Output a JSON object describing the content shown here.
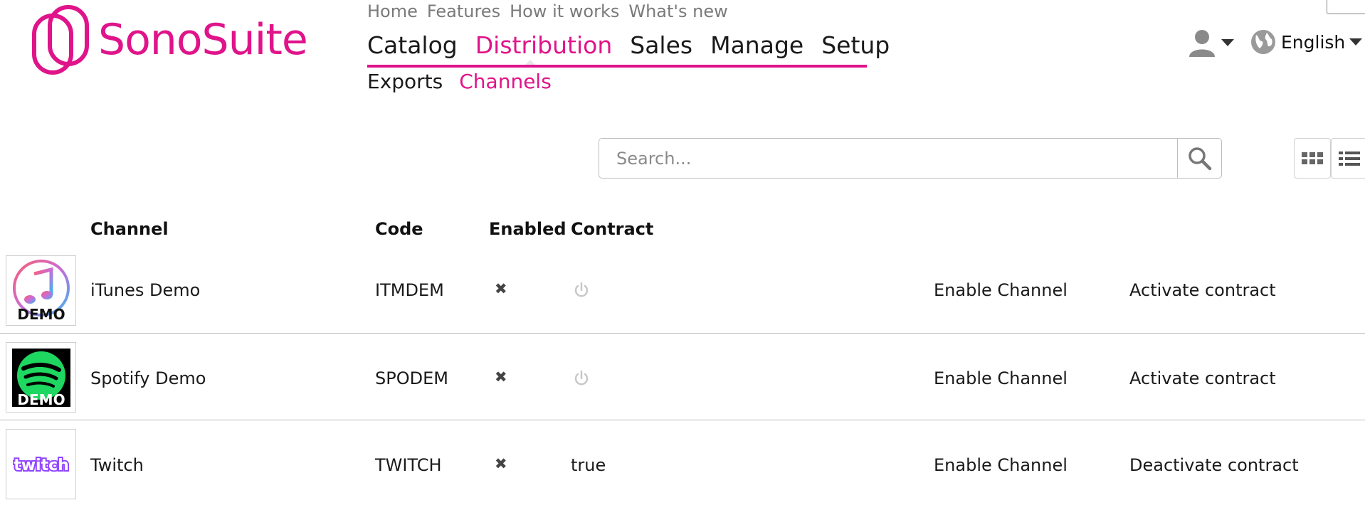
{
  "header": {
    "logo_text": "SonoSuite",
    "top_links": [
      "Home",
      "Features",
      "How it works",
      "What's new"
    ],
    "main_nav": [
      "Catalog",
      "Distribution",
      "Sales",
      "Manage",
      "Setup"
    ],
    "main_nav_active": "Distribution",
    "sub_nav": [
      "Exports",
      "Channels"
    ],
    "sub_nav_active": "Channels",
    "language": "English"
  },
  "search": {
    "placeholder": "Search..."
  },
  "table": {
    "headers": {
      "channel": "Channel",
      "code": "Code",
      "enabled": "Enabled",
      "contract": "Contract"
    },
    "rows": [
      {
        "channel": "iTunes Demo",
        "code": "ITMDEM",
        "enabled": "✖",
        "contract": "",
        "enable_action": "Enable Channel",
        "contract_action": "Activate contract",
        "thumb_label": "DEMO"
      },
      {
        "channel": "Spotify Demo",
        "code": "SPODEM",
        "enabled": "✖",
        "contract": "",
        "enable_action": "Enable Channel",
        "contract_action": "Activate contract",
        "thumb_label": "DEMO"
      },
      {
        "channel": "Twitch",
        "code": "TWITCH",
        "enabled": "✖",
        "contract": "true",
        "enable_action": "Enable Channel",
        "contract_action": "Deactivate contract",
        "thumb_label": "twitch"
      }
    ]
  },
  "colors": {
    "brand": "#e0148a",
    "text": "#1a1a1a",
    "muted": "#7a7a7a"
  }
}
